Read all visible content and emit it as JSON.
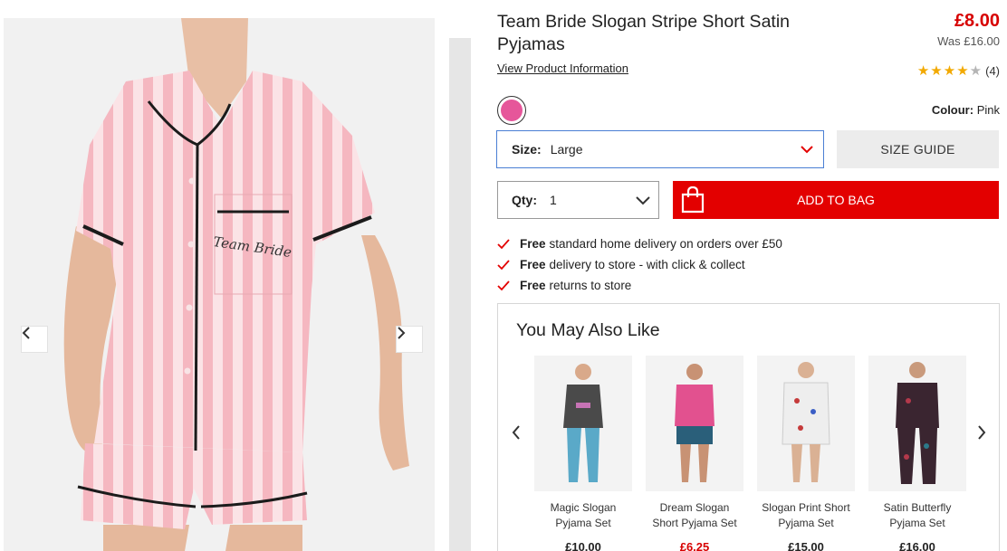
{
  "product": {
    "title": "Team Bride Slogan Stripe Short Satin Pyjamas",
    "view_info_label": "View Product Information",
    "price": "£8.00",
    "was_price": "Was £16.00",
    "rating_stars": 4,
    "rating_max": 5,
    "rating_count": "(4)",
    "colour_label": "Colour:",
    "colour_value": "Pink",
    "swatch_color": "#e6569a",
    "size_label": "Size:",
    "size_value": "Large",
    "size_guide_label": "SIZE GUIDE",
    "qty_label": "Qty:",
    "qty_value": "1",
    "add_to_bag_label": "ADD TO BAG",
    "shirt_slogan": "Team Bride",
    "accent_color": "#e30000"
  },
  "benefits": [
    {
      "bold": "Free",
      "text": "standard home delivery on orders over £50"
    },
    {
      "bold": "Free",
      "text": "delivery to store - with click & collect"
    },
    {
      "bold": "Free",
      "text": "returns to store"
    }
  ],
  "recommendations": {
    "title": "You May Also Like",
    "items": [
      {
        "name": "Magic Slogan Pyjama Set",
        "price": "£10.00",
        "sale": false
      },
      {
        "name": "Dream Slogan Short Pyjama Set",
        "price": "£6.25",
        "sale": true
      },
      {
        "name": "Slogan Print Short Pyjama Set",
        "price": "£15.00",
        "sale": false
      },
      {
        "name": "Satin Butterfly Pyjama Set",
        "price": "£16.00",
        "sale": false
      }
    ]
  }
}
